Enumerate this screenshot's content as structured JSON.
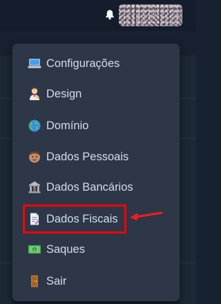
{
  "menu": {
    "items": [
      {
        "label": "Configurações",
        "icon": "laptop-icon"
      },
      {
        "label": "Design",
        "icon": "artist-icon"
      },
      {
        "label": "Domínio",
        "icon": "globe-icon"
      },
      {
        "label": "Dados Pessoais",
        "icon": "person-face-icon"
      },
      {
        "label": "Dados Bancários",
        "icon": "bank-icon"
      },
      {
        "label": "Dados Fiscais",
        "icon": "document-icon"
      },
      {
        "label": "Saques",
        "icon": "money-icon"
      },
      {
        "label": "Sair",
        "icon": "door-icon"
      }
    ]
  },
  "highlight": {
    "target": "Dados Fiscais",
    "color": "#ff0000"
  },
  "colors": {
    "menu_bg": "#2d3748",
    "page_bg": "#17212f",
    "text": "#d6dde8"
  }
}
